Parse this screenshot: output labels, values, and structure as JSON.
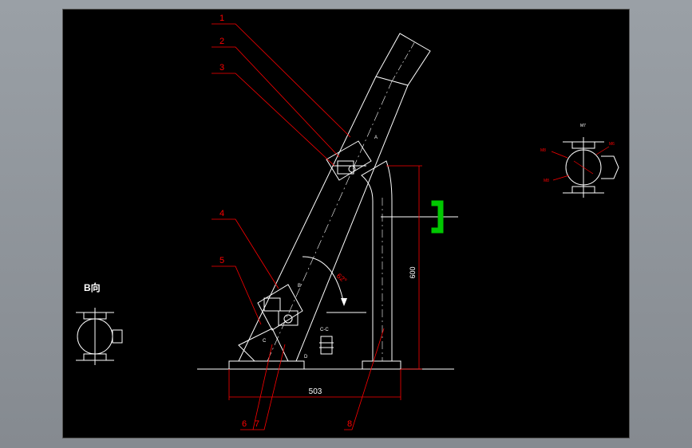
{
  "colors": {
    "background": "#000000",
    "frame": "#8f9398",
    "geometry": "#ffffff",
    "leader": "#ff0000",
    "dimension": "#ff0000",
    "bracket": "#00c800"
  },
  "part_labels": [
    "1",
    "2",
    "3",
    "4",
    "5",
    "6",
    "7",
    "8"
  ],
  "dimensions": {
    "base_length": "503",
    "height": "600",
    "angle": "62°"
  },
  "views": {
    "b_view": "B向",
    "section_marker": "C-C",
    "detail_labels": [
      "M7",
      "M8",
      "M6",
      "M8"
    ]
  },
  "annotations": {
    "a": "A",
    "b": "B",
    "c": "C",
    "d": "D"
  }
}
